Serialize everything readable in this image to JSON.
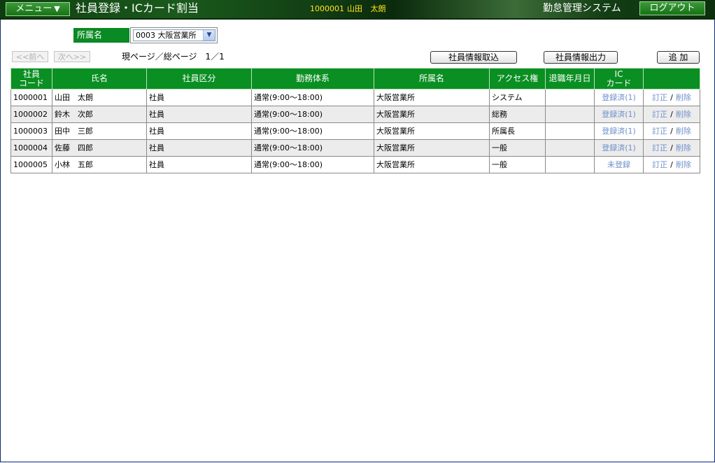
{
  "header": {
    "menu_label": "メニュー",
    "menu_arrow": "▼",
    "page_title": "社員登録・ICカード割当",
    "user_code": "1000001",
    "user_name": "山田 太朗",
    "system_name": "勤怠管理システム",
    "logout_label": "ログアウト"
  },
  "filter": {
    "label": "所属名",
    "selected": "0003 大阪営業所"
  },
  "nav": {
    "prev_label": "<<前へ",
    "next_label": "次へ>>",
    "page_info": "現ページ／総ページ　1／1"
  },
  "actions": {
    "import_label": "社員情報取込",
    "export_label": "社員情報出力",
    "add_label": "追 加"
  },
  "table": {
    "headers": {
      "code_line1": "社員",
      "code_line2": "コード",
      "name": "氏名",
      "type": "社員区分",
      "shift": "勤務体系",
      "dept": "所属名",
      "access": "アクセス権",
      "retire": "退職年月日",
      "ic_line1": "IC",
      "ic_line2": "カード",
      "ops": ""
    },
    "edit_label": "訂正",
    "sep": "/",
    "delete_label": "削除",
    "rows": [
      {
        "code": "1000001",
        "name": "山田　太朗",
        "type": "社員",
        "shift": "通常(9:00～18:00)",
        "dept": "大阪営業所",
        "access": "システム",
        "retire": "",
        "ic": "登録済(1)"
      },
      {
        "code": "1000002",
        "name": "鈴木　次郎",
        "type": "社員",
        "shift": "通常(9:00～18:00)",
        "dept": "大阪営業所",
        "access": "総務",
        "retire": "",
        "ic": "登録済(1)"
      },
      {
        "code": "1000003",
        "name": "田中　三郎",
        "type": "社員",
        "shift": "通常(9:00～18:00)",
        "dept": "大阪営業所",
        "access": "所属長",
        "retire": "",
        "ic": "登録済(1)"
      },
      {
        "code": "1000004",
        "name": "佐藤　四郎",
        "type": "社員",
        "shift": "通常(9:00～18:00)",
        "dept": "大阪営業所",
        "access": "一般",
        "retire": "",
        "ic": "登録済(1)"
      },
      {
        "code": "1000005",
        "name": "小林　五郎",
        "type": "社員",
        "shift": "通常(9:00～18:00)",
        "dept": "大阪営業所",
        "access": "一般",
        "retire": "",
        "ic": "未登録"
      }
    ]
  },
  "colors": {
    "header_green": "#0a8f22",
    "user_yellow": "#ffe51a",
    "link_blue": "#6f8fca"
  }
}
